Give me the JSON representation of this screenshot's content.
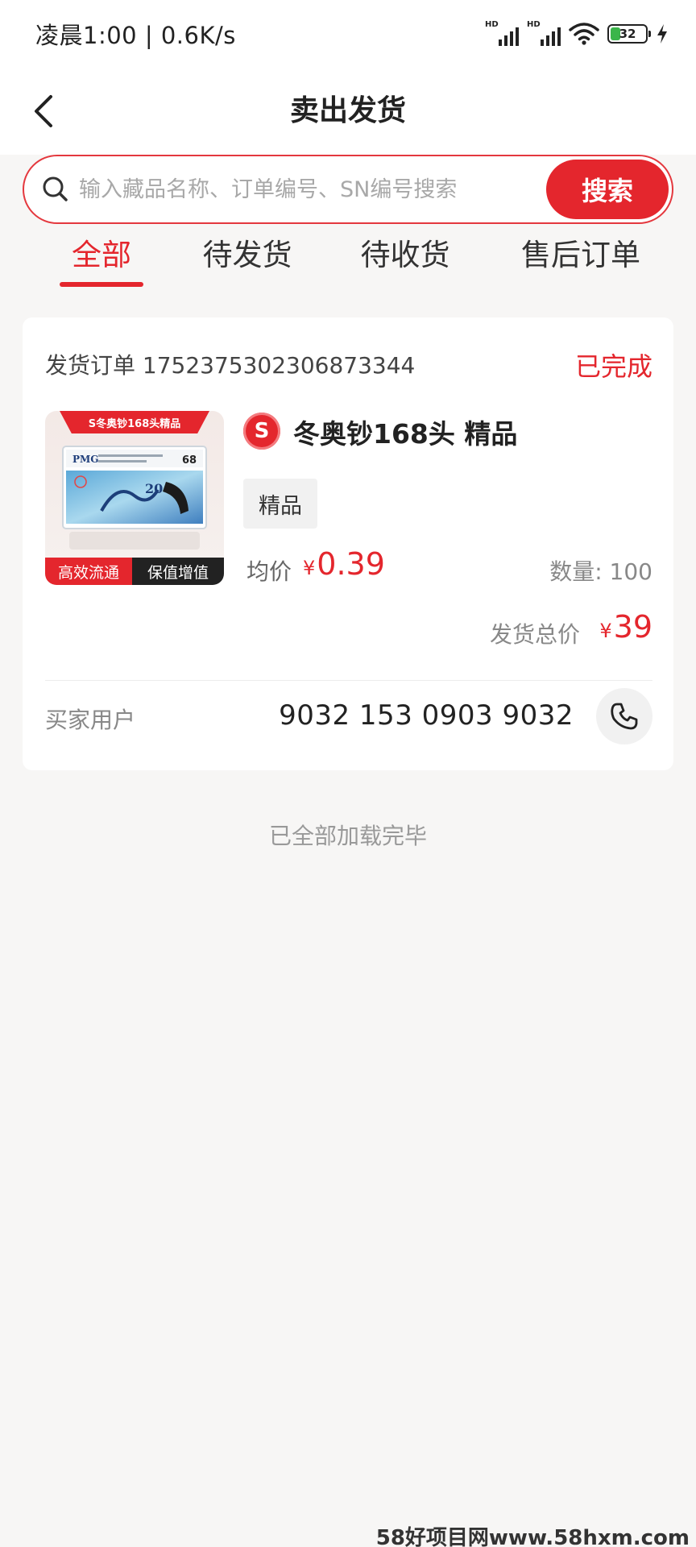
{
  "status_bar": {
    "time": "凌晨1:00 | 0.6K/s",
    "signal1_label": "HD",
    "signal2_label": "HD",
    "battery": "32"
  },
  "nav": {
    "title": "卖出发货"
  },
  "search": {
    "placeholder": "输入藏品名称、订单编号、SN编号搜索",
    "value": "",
    "button_label": "搜索"
  },
  "tabs": [
    {
      "label": "全部",
      "active": true
    },
    {
      "label": "待发货",
      "active": false
    },
    {
      "label": "待收货",
      "active": false
    },
    {
      "label": "售后订单",
      "active": false
    }
  ],
  "order": {
    "order_no": "发货订单 1752375302306873344",
    "status": "已完成",
    "thumbnail": {
      "banner": "S冬奥钞168头精品",
      "card_label": "PMG",
      "grade": "68",
      "note_value": "20",
      "tag_left": "高效流通",
      "tag_right": "保值增值"
    },
    "brand_letter": "S",
    "product_name": "冬奥钞168头 精品",
    "grade_tag": "精品",
    "avg_label": "均价",
    "currency": "¥",
    "avg_price": "0.39",
    "quantity": "数量: 100",
    "total_label": "发货总价",
    "total_price": "39",
    "buyer_label": "买家用户",
    "buyer_phone": "9032 153 0903 9032"
  },
  "footer": {
    "end_text": "已全部加载完毕"
  },
  "watermark": "58好项目网www.58hxm.com",
  "colors": {
    "accent": "#e4262d",
    "background": "#f7f6f5"
  }
}
